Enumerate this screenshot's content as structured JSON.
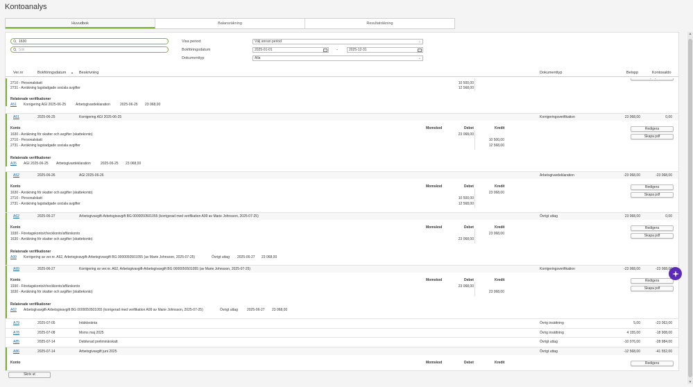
{
  "page": {
    "title": "Kontoanalys"
  },
  "tabs": [
    {
      "label": "Huvudbok",
      "active": true
    },
    {
      "label": "Balansräkning",
      "active": false
    },
    {
      "label": "Resultaträkning",
      "active": false
    }
  ],
  "filters": {
    "account_search_value": "1630",
    "text_search_placeholder": "Sök",
    "period_label": "Visa period",
    "period_value": "Välj annan period",
    "date_label": "Bokföringsdatum",
    "date_from": "2025-01-01",
    "date_separator": "-",
    "date_to": "2025-12-31",
    "doctype_label": "Dokumenttyp",
    "doctype_value": "Alla"
  },
  "table_header": {
    "ver_nr": "Ver.nr",
    "bokforingsdatum": "Bokföringsdatum",
    "sort_arrow": "▲",
    "beskrivning": "Beskrivning",
    "dokumenttyp": "Dokumenttyp",
    "belopp": "Belopp",
    "kontosaldo": "Kontosaldo"
  },
  "labels": {
    "konto": "Konto",
    "momskod": "Momskod",
    "debet": "Debet",
    "kredit": "Kredit",
    "relaterade": "Relaterade verifikationer",
    "redigera": "Redigera",
    "skapa_pdf": "Skapa pdf",
    "skriv_ut": "Skriv ut"
  },
  "partial_top": {
    "lines": [
      "2710 - Personalskatt",
      "2731 - Avräkning lagstadgade sociala avgifter"
    ],
    "debet": [
      "10 500,00",
      "12 568,00"
    ],
    "related": {
      "ver": "A51",
      "desc": "Korrigering AGI 2025-06-25",
      "type": "Arbetsgivardeklaration",
      "date": "2025-06-25",
      "amount": "23 068,00"
    }
  },
  "entries": [
    {
      "ver": "A51",
      "date": "2025-06-25",
      "desc": "Korrigering AGI 2025-06-25",
      "doctype": "Korrigeringsverifikation",
      "belopp": "23 068,00",
      "saldo": "0,00",
      "lines": [
        "1630 - Avräkning för skatter och avgifter (skattekonto)",
        "2710 - Personalskatt",
        "2731 - Avräkning lagstadgade sociala avgifter"
      ],
      "debet": [
        "23 068,00",
        "",
        ""
      ],
      "kredit": [
        "",
        "10 500,00",
        "12 568,00"
      ],
      "related": {
        "ver": "A35",
        "desc": "AGI 2025-06-25",
        "type": "Arbetsgivardeklaration",
        "date": "2025-06-25",
        "amount": "23 068,00"
      }
    },
    {
      "ver": "A52",
      "date": "2025-06-26",
      "desc": "AGI 2025-06-26",
      "doctype": "Arbetsgivardeklaration",
      "belopp": "-23 068,00",
      "saldo": "-23 068,00",
      "lines": [
        "1630 - Avräkning för skatter och avgifter (skattekonto)",
        "2710 - Personalskatt",
        "2731 - Avräkning lagstadgade sociala avgifter"
      ],
      "debet": [
        "",
        "10 500,00",
        "12 568,00"
      ],
      "kredit": [
        "23 068,00",
        "",
        ""
      ]
    },
    {
      "ver": "A62",
      "date": "2025-06-27",
      "desc": "Arbetsgivavgift-Arbetsgivavgift BG 0000050501055 (korrigerad med verifikation A99 av Marie Johnsson, 2025-07-25)",
      "doctype": "Övrigt uttag",
      "belopp": "23 068,00",
      "saldo": "0,00",
      "lines": [
        "1930 - Företagskonto/checkkonto/affärskonto",
        "1630 - Avräkning för skatter och avgifter (skattekonto)"
      ],
      "debet": [
        "",
        "23 068,00"
      ],
      "kredit": [
        "23 068,00",
        ""
      ],
      "related": {
        "ver": "A99",
        "desc": "Korrigering av ver.nr. A62, Arbetsgivavgift-Arbetsgivavgift BG 0000050501055 (av Marie Johnsson, 2025-07-25)",
        "type": "Övrigt uttag",
        "date": "2025-06-27",
        "amount": "23 068,00"
      }
    },
    {
      "ver": "A99",
      "date": "2025-06-27",
      "desc": "Korrigering av ver.nr. A62, Arbetsgivavgift-Arbetsgivavgift BG 0000050501055 (av Marie Johnsson, 2025-07-25)",
      "doctype": "Korrigeringsverifikation",
      "belopp": "-23 068,00",
      "saldo": "-23 068,00",
      "lines": [
        "1930 - Företagskonto/checkkonto/affärskonto",
        "1630 - Avräkning för skatter och avgifter (skattekonto)"
      ],
      "debet": [
        "23 068,00",
        ""
      ],
      "kredit": [
        "",
        "23 068,00"
      ],
      "related": {
        "ver": "A62",
        "desc": "Arbetsgivavgift-Arbetsgivavgift BG 0000050501055 (korrigerad med verifikation A99 av Marie Johnsson, 2025-07-25)",
        "type": "Övrigt uttag",
        "date": "2025-06-27",
        "amount": "23 068,00"
      }
    }
  ],
  "simple_rows": [
    {
      "ver": "A79",
      "date": "2025-07-05",
      "desc": "Intäktsränta",
      "doctype": "Övrig insättning",
      "belopp": "5,00",
      "saldo": "-23 063,00"
    },
    {
      "ver": "A78",
      "date": "2025-07-08",
      "desc": "Moms maj 2025",
      "doctype": "Övrig insättning",
      "belopp": "4 155,00",
      "saldo": "-18 908,00"
    },
    {
      "ver": "A85",
      "date": "2025-07-14",
      "desc": "Debiterad preliminärskatt",
      "doctype": "Övrigt uttag",
      "belopp": "-10 076,00",
      "saldo": "-28 984,00"
    }
  ],
  "last_row": {
    "ver": "A86",
    "date": "2025-07-14",
    "desc": "Arbetsgivavgift juni 2025",
    "doctype": "Övrigt uttag",
    "belopp": "-12 568,00",
    "saldo": "-41 552,00"
  },
  "colors": {
    "accent": "#78b130",
    "link": "#1b67a6",
    "fab": "#5b2bb5"
  }
}
